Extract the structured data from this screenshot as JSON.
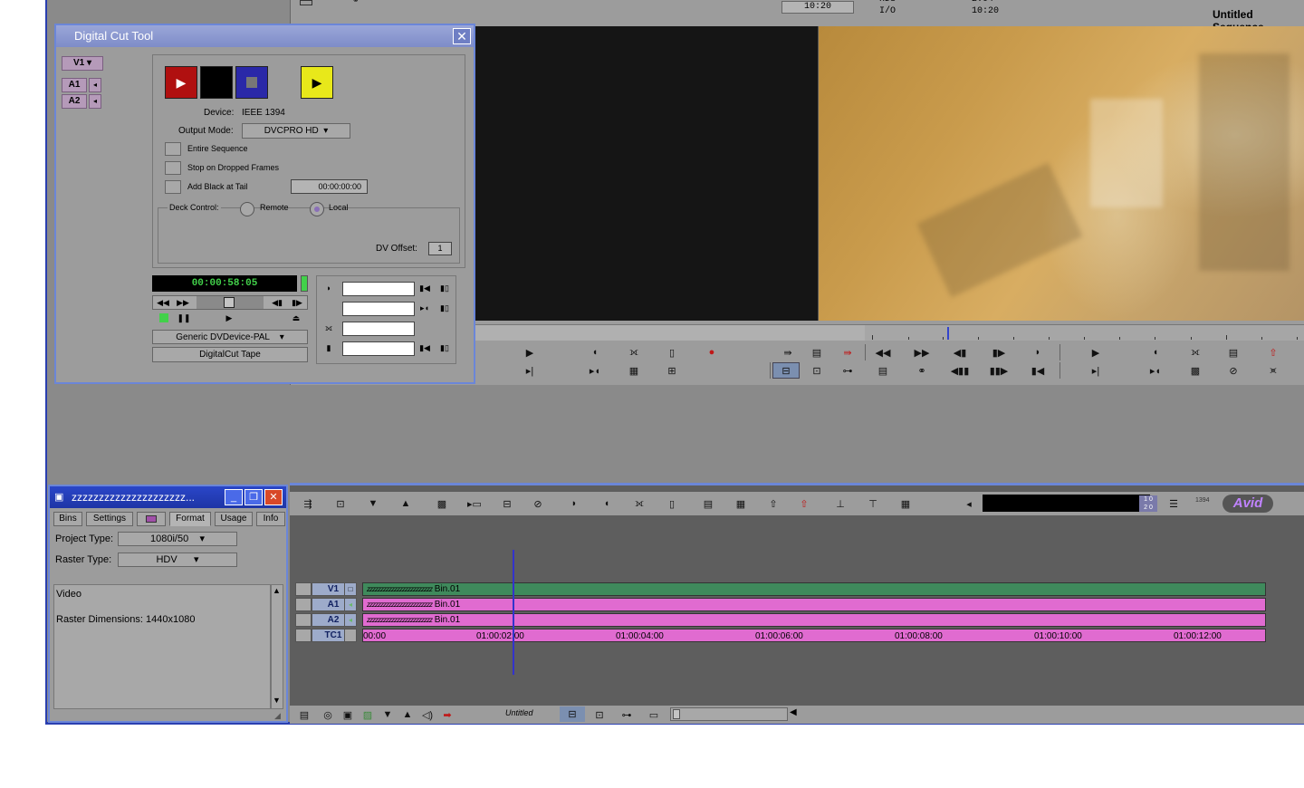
{
  "composer": {
    "tc_top_left": "10:20",
    "status_a": "I/O",
    "status_b": "10:20",
    "sequence_title": "Untitled Sequence"
  },
  "digital_cut_tool": {
    "title": "Digital Cut Tool",
    "video_track_button": "V1",
    "audio_track_buttons": [
      "A1",
      "A2"
    ],
    "device_label": "Device:",
    "device_value": "IEEE 1394",
    "output_mode_label": "Output Mode:",
    "output_mode_value": "DVCPRO HD",
    "entire_sequence_label": "Entire Sequence",
    "stop_dropped_label": "Stop on Dropped Frames",
    "add_black_label": "Add Black at Tail",
    "add_black_value": "00:00:00:00",
    "deck_control_label": "Deck Control:",
    "remote_label": "Remote",
    "local_label": "Local",
    "dv_offset_label": "DV Offset:",
    "dv_offset_value": "1",
    "timecode_display": "00:00:58:05",
    "deck_select_value": "Generic DVDevice-PAL",
    "tape_button_label": "DigitalCut Tape"
  },
  "project_window": {
    "title": "zzzzzzzzzzzzzzzzzzzzz...",
    "tabs": [
      "Bins",
      "Settings",
      "",
      "Format",
      "Usage",
      "Info"
    ],
    "active_tab": "Format",
    "project_type_label": "Project Type:",
    "project_type_value": "1080i/50",
    "raster_type_label": "Raster Type:",
    "raster_type_value": "HDV",
    "info_heading": "Video",
    "raster_dimensions": "Raster Dimensions: 1440x1080"
  },
  "timeline": {
    "logo": "Avid",
    "tracks": [
      {
        "label": "V1",
        "clip_prefix": "zzzzzzzzzzzzzzzzzzzzzzzz",
        "clip_name": "Bin.01"
      },
      {
        "label": "A1",
        "clip_prefix": "zzzzzzzzzzzzzzzzzzzzzzzz",
        "clip_name": "Bin.01"
      },
      {
        "label": "A2",
        "clip_prefix": "zzzzzzzzzzzzzzzzzzzzzzzz",
        "clip_name": "Bin.01"
      }
    ],
    "tc_track_label": "TC1",
    "timecodes": [
      "00:00",
      "01:00:02:00",
      "01:00:04:00",
      "01:00:06:00",
      "01:00:08:00",
      "01:00:10:00",
      "01:00:12:00"
    ],
    "sequence_name": "Untitled",
    "small_badge": "1394"
  },
  "colors": {
    "window_border": "#6b86d8",
    "video_track": "#3f8a5c",
    "audio_track": "#e06bd0",
    "record_button": "#b01010",
    "play_button": "#e8e81a",
    "avid_logo": "#c083ff"
  }
}
